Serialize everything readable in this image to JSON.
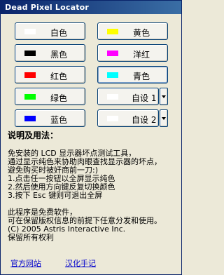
{
  "window": {
    "title": "Dead Pixel Locator"
  },
  "colors": [
    {
      "label": "白色",
      "swatch": "#ffffff"
    },
    {
      "label": "黄色",
      "swatch": "#ffff00"
    },
    {
      "label": "黑色",
      "swatch": "#000000"
    },
    {
      "label": "洋红",
      "swatch": "#ff00ff"
    },
    {
      "label": "红色",
      "swatch": "#ff0000"
    },
    {
      "label": "青色",
      "swatch": "#00ffff"
    },
    {
      "label": "绿色",
      "swatch": "#00ff00"
    },
    {
      "label": "自设 1",
      "swatch": "#ffffff"
    },
    {
      "label": "蓝色",
      "swatch": "#0000ff"
    },
    {
      "label": "自设 2",
      "swatch": "#ffffff"
    }
  ],
  "usage": {
    "heading": "说明及用法：",
    "lines": [
      "免安装的 LCD 显示器坏点测试工具，",
      "通过显示纯色来协助肉眼查找显示器的坏点，",
      "避免购买时被奸商前一刀:)",
      "1.点击任一按钮以全屏显示纯色",
      "2.然后使用方向键反复切换颜色",
      "3.按下 Esc 键则可退出全屏"
    ]
  },
  "about": {
    "lines": [
      "此程序是免费软件，",
      "可在保留版权信息的前提下任意分发和使用。",
      "(C) 2005 Astris Interactive Inc.",
      "保留所有权利"
    ]
  },
  "links": {
    "official": "官方网站",
    "localization": "汉化手记"
  },
  "icons": {
    "dropdown": "chevron-down-icon"
  }
}
